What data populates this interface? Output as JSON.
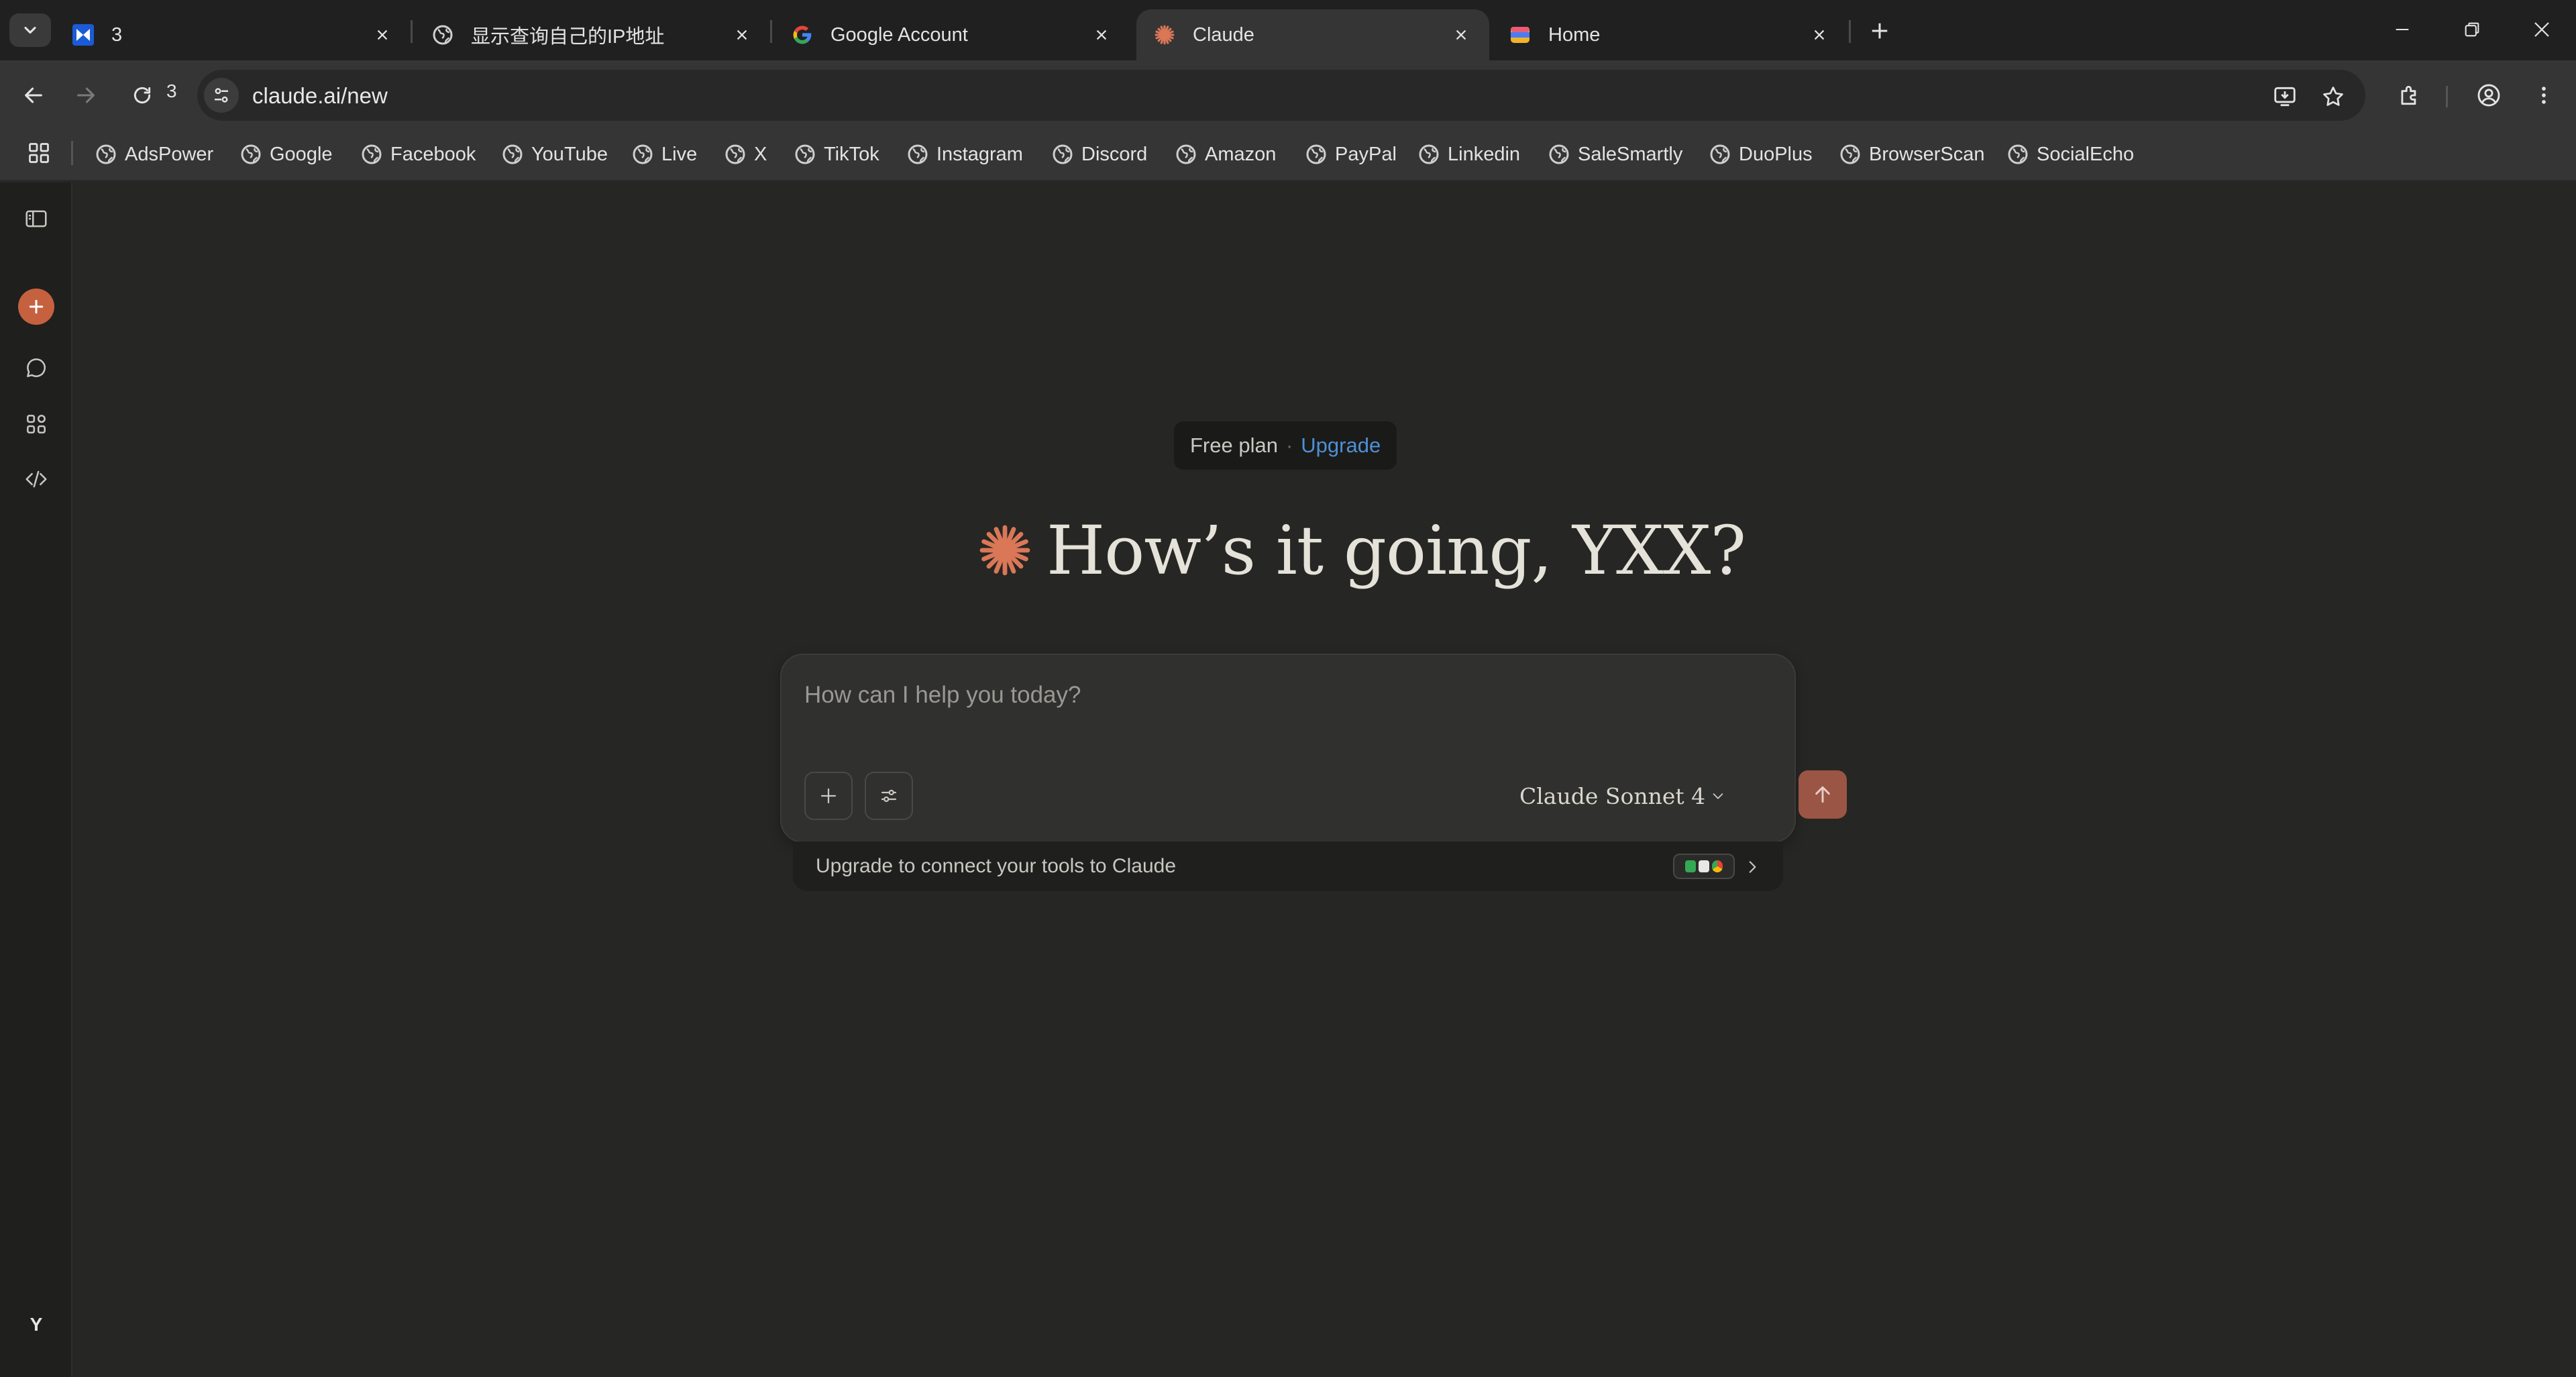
{
  "browser": {
    "tabs": [
      {
        "title": "3",
        "icon": "app-logo-icon",
        "active": false
      },
      {
        "title": "显示查询自己的IP地址",
        "icon": "globe-icon",
        "active": false
      },
      {
        "title": "Google Account",
        "icon": "google-g-icon",
        "active": false
      },
      {
        "title": "Claude",
        "icon": "claude-spark-icon",
        "active": true
      },
      {
        "title": "Home",
        "icon": "home-app-icon",
        "active": false
      }
    ],
    "tab_count": "3",
    "url": "claude.ai/new",
    "bookmarks": [
      "AdsPower",
      "Google",
      "Facebook",
      "YouTube",
      "Live",
      "X",
      "TikTok",
      "Instagram",
      "Discord",
      "Amazon",
      "PayPal",
      "Linkedin",
      "SaleSmartly",
      "DuoPlus",
      "BrowserScan",
      "SocialEcho"
    ]
  },
  "claude": {
    "plan": {
      "label": "Free plan",
      "separator": "·",
      "upgrade": "Upgrade"
    },
    "greeting": "How’s it going, YXX?",
    "composer": {
      "placeholder": "How can I help you today?",
      "model": "Claude Sonnet 4"
    },
    "connect_bar": {
      "label": "Upgrade to connect your tools to Claude"
    },
    "user_initial": "Y",
    "colors": {
      "accent": "#c6613f",
      "send_button": "#9a5544",
      "upgrade_link": "#4f8fd6",
      "background": "#262624"
    }
  }
}
